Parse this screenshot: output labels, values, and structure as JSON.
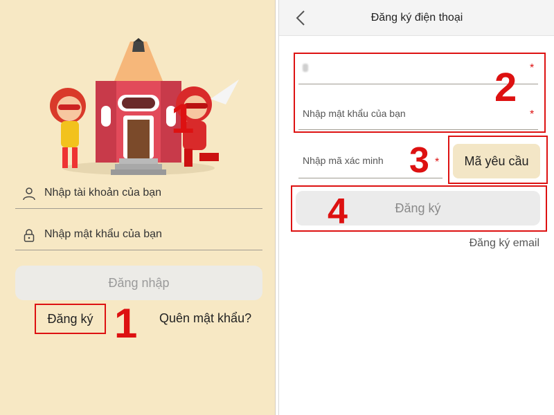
{
  "left": {
    "username_placeholder": "Nhập tài khoản của bạn",
    "password_placeholder": "Nhập mật khẩu của bạn",
    "login_label": "Đăng nhập",
    "register_label": "Đăng ký",
    "forgot_label": "Quên mật khẩu?",
    "markers": [
      "1",
      "1"
    ]
  },
  "right": {
    "title": "Đăng ký điện thoại",
    "password_placeholder": "Nhập mật khẩu của bạn",
    "code_placeholder": "Nhập mã xác minh",
    "request_code_label": "Mã yêu cầu",
    "register_label": "Đăng ký",
    "email_register_label": "Đăng ký email",
    "required_mark": "*",
    "markers": [
      "2",
      "3",
      "4"
    ]
  },
  "colors": {
    "accent_red": "#dd1111",
    "left_bg": "#f7e8c4",
    "request_btn": "#f3e6c6"
  },
  "icons": [
    "user-icon",
    "lock-icon",
    "back-chevron-icon"
  ]
}
